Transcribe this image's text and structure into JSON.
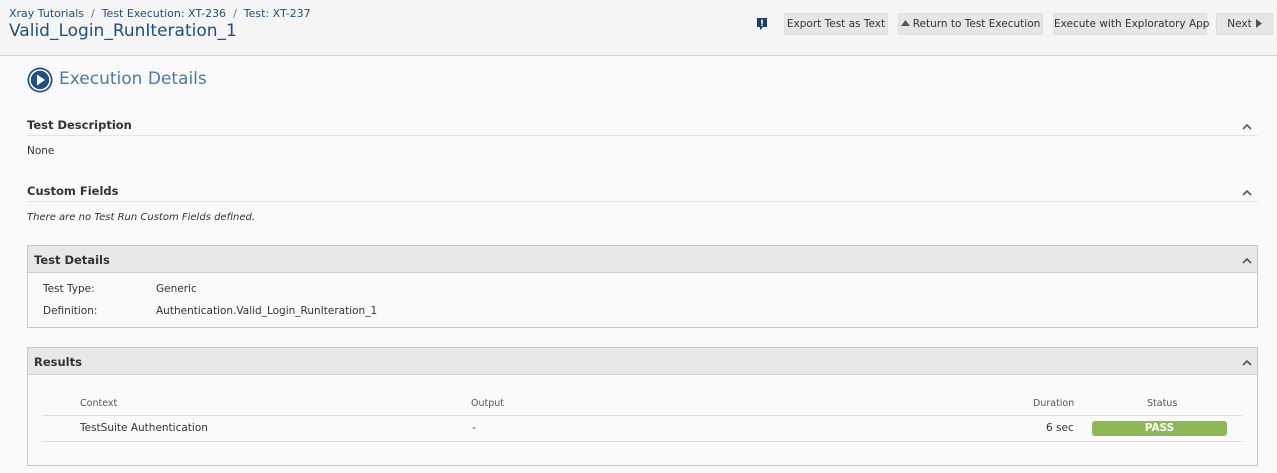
{
  "breadcrumb": {
    "items": [
      "Xray Tutorials",
      "Test Execution: XT-236",
      "Test: XT-237"
    ],
    "separator": "/"
  },
  "page_title": "Valid_Login_RunIteration_1",
  "toolbar": {
    "feedback_icon": "feedback-icon",
    "export_label": "Export Test as Text",
    "return_label": "Return to Test Execution",
    "exploratory_label": "Execute with Exploratory App",
    "next_label": "Next"
  },
  "execution": {
    "title": "Execution Details",
    "icon": "play-circle-icon",
    "accent": "#205081"
  },
  "description": {
    "title": "Test Description",
    "value": "None"
  },
  "custom_fields": {
    "title": "Custom Fields",
    "value": "There are no Test Run Custom Fields defined."
  },
  "test_details": {
    "title": "Test Details",
    "rows": [
      {
        "key": "Test Type:",
        "value": "Generic"
      },
      {
        "key": "Definition:",
        "value": "Authentication.Valid_Login_RunIteration_1"
      }
    ]
  },
  "results": {
    "title": "Results",
    "columns": [
      "Context",
      "Output",
      "Duration",
      "Status"
    ],
    "rows": [
      {
        "context": "TestSuite Authentication",
        "output": "-",
        "duration": "6 sec",
        "status": "PASS",
        "status_color": "#8eb856"
      }
    ]
  }
}
